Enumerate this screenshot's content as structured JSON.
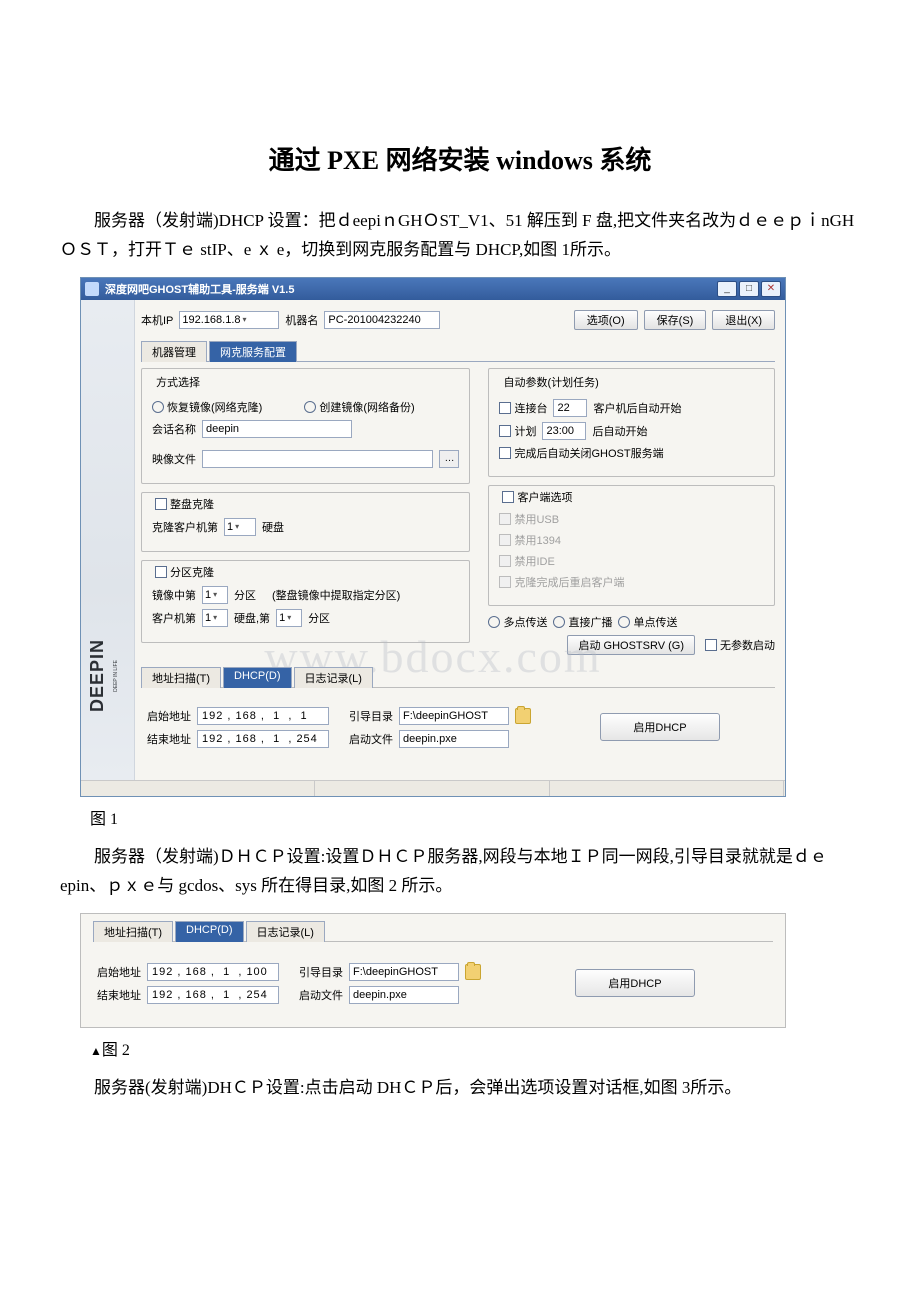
{
  "doc": {
    "title": "通过 PXE 网络安装 windows 系统",
    "para1_a": "服务器（发射端)DHCP 设置：把ｄeepiｎGHＯST_V1、51 解压到 F 盘,把文件夹名改为ｄｅｅｐｉnGHＯＳＴ，打开Ｔｅ stIP、e ｘ e，切换到网克服务配置与 DHCP,如图 1所示。",
    "fig1": "图 1",
    "para2": "服务器（发射端)ＤＨＣＰ设置:设置ＤＨＣＰ服务器,网段与本地ＩＰ同一网段,引导目录就就是ｄｅ epin、ｐｘｅ与 gcdos、sys 所在得目录,如图 2 所示。",
    "fig2_sym": "▲",
    "fig2": "图 2",
    "para3": "服务器(发射端)DHＣＰ设置:点击启动 DHＣＰ后，会弹出选项设置对话框,如图 3所示。"
  },
  "app": {
    "title": "深度网吧GHOST辅助工具-服务端 V1.5",
    "top": {
      "iplabel": "本机IP",
      "ip": "192.168.1.8",
      "namelabel": "机器名",
      "name": "PC-201004232240",
      "btn_opt": "选项(O)",
      "btn_save": "保存(S)",
      "btn_exit": "退出(X)"
    },
    "tabs": {
      "t1": "机器管理",
      "t2": "网克服务配置"
    },
    "mode": {
      "title": "方式选择",
      "r1": "恢复镜像(网络克隆)",
      "r2": "创建镜像(网络备份)",
      "sesslabel": "会话名称",
      "sess": "deepin",
      "imglabel": "映像文件"
    },
    "full": {
      "title": "整盘克隆",
      "line": "克隆客户机第",
      "val": "1",
      "suffix": "硬盘"
    },
    "part": {
      "title": "分区克隆",
      "l1a": "镜像中第",
      "v1": "1",
      "l1b": "分区",
      "l1c": "(整盘镜像中提取指定分区)",
      "l2a": "客户机第",
      "v2": "1",
      "l2b": "硬盘,第",
      "v3": "1",
      "l2c": "分区"
    },
    "auto": {
      "title": "自动参数(计划任务)",
      "c1a": "连接台",
      "c1v": "22",
      "c1b": "客户机后自动开始",
      "c2a": "计划",
      "c2v": "23:00",
      "c2b": "后自动开始",
      "c3": "完成后自动关闭GHOST服务端"
    },
    "client": {
      "title": "客户端选项",
      "o1": "禁用USB",
      "o2": "禁用1394",
      "o3": "禁用IDE",
      "o4": "克隆完成后重启客户端"
    },
    "cast": {
      "r1": "多点传送",
      "r2": "直接广播",
      "r3": "单点传送"
    },
    "start": {
      "btn": "启动 GHOSTSRV (G)",
      "chk": "无参数启动"
    },
    "subtabs": {
      "t1": "地址扫描(T)",
      "t2": "DHCP(D)",
      "t3": "日志记录(L)"
    },
    "dhcp": {
      "startlabel": "启始地址",
      "start": "192 , 168 ,  1  ,  1",
      "endlabel": "结束地址",
      "end": "192 , 168 ,  1  , 254",
      "bootdirlabel": "引导目录",
      "bootdir": "F:\\deepinGHOST",
      "bootfilelabel": "启动文件",
      "bootfile": "deepin.pxe",
      "btn": "启用DHCP"
    }
  },
  "panel2": {
    "start": "192 , 168 ,  1  , 100",
    "end": "192 , 168 ,  1  , 254",
    "bootdir": "F:\\deepinGHOST",
    "bootfile": "deepin.pxe"
  },
  "logo": {
    "main": "DEEPIN",
    "sub": "DEEP IN LIFE"
  },
  "wm": "www.bdocx.com"
}
